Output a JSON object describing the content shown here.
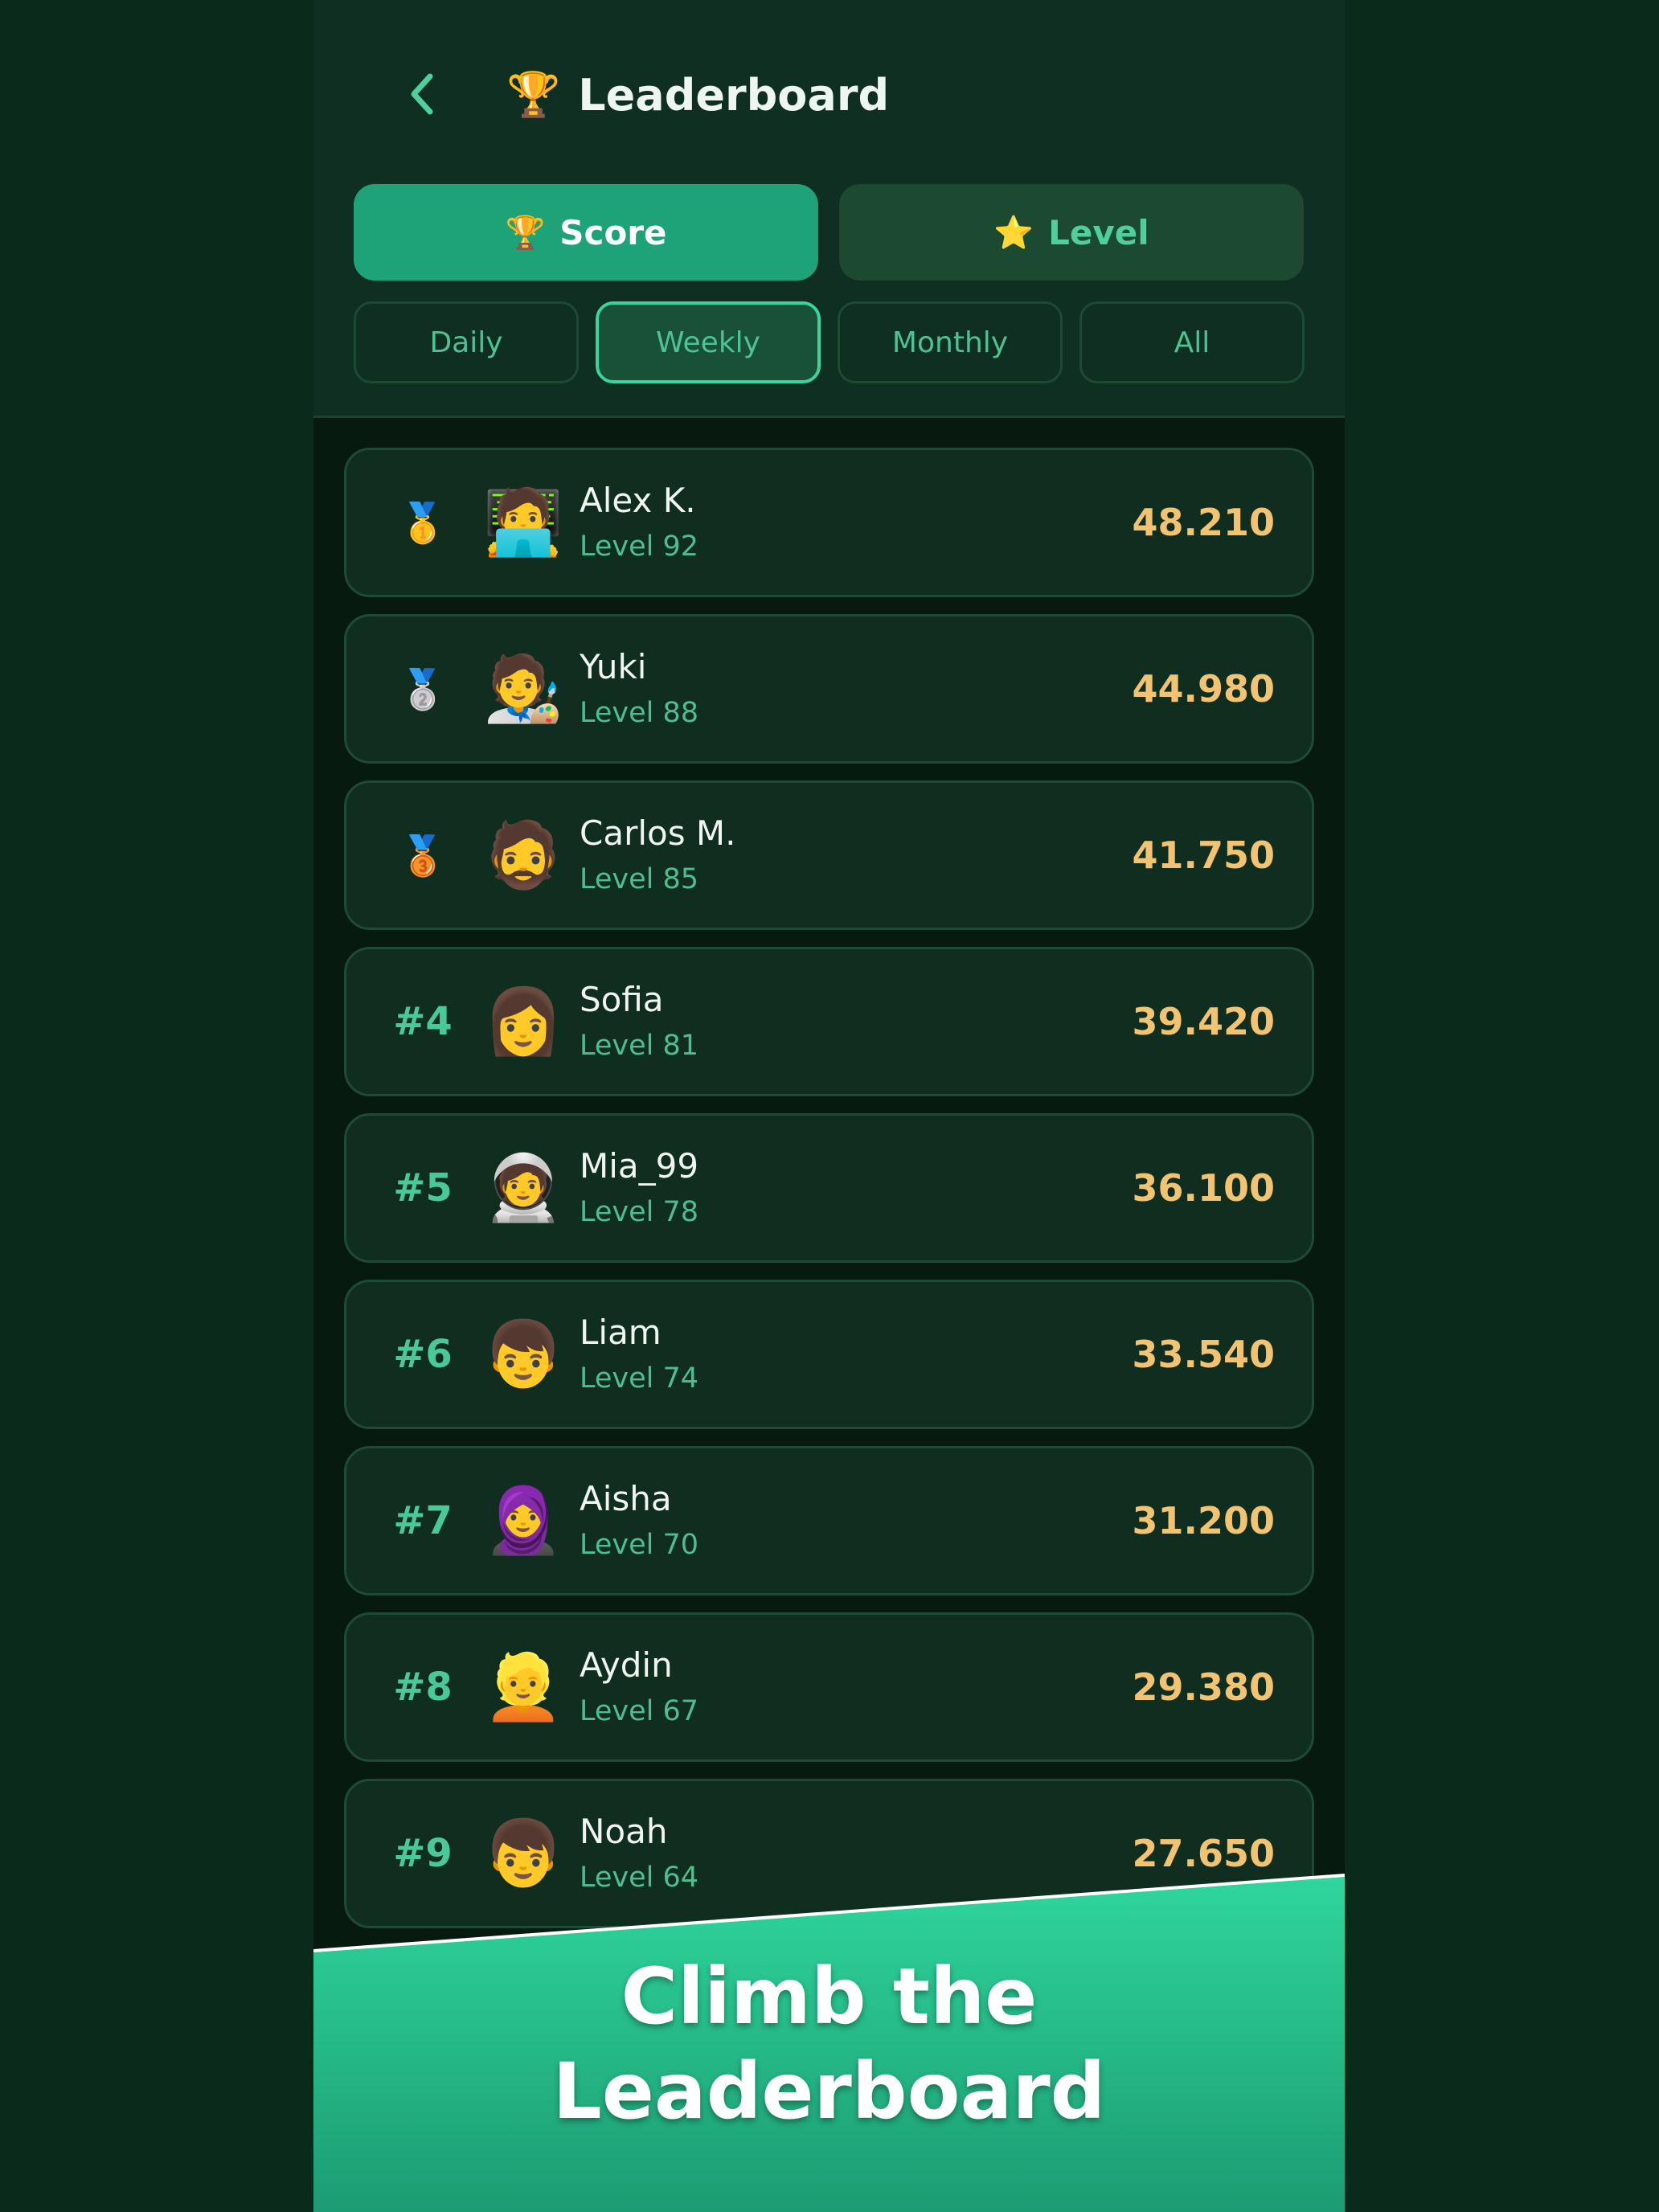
{
  "header": {
    "back_icon": "chevron-left-icon",
    "title_icon": "🏆",
    "title": "Leaderboard"
  },
  "tabs": {
    "score": {
      "icon": "🏆",
      "label": "Score",
      "active": true
    },
    "level": {
      "icon": "⭐",
      "label": "Level",
      "active": false
    }
  },
  "periods": [
    {
      "label": "Daily",
      "active": false
    },
    {
      "label": "Weekly",
      "active": true
    },
    {
      "label": "Monthly",
      "active": false
    },
    {
      "label": "All",
      "active": false
    }
  ],
  "rows": [
    {
      "rank": "🥇",
      "avatar": "🧑‍💻",
      "name": "Alex K.",
      "level": "Level 92",
      "score": "48.210"
    },
    {
      "rank": "🥈",
      "avatar": "🧑‍🎨",
      "name": "Yuki",
      "level": "Level 88",
      "score": "44.980"
    },
    {
      "rank": "🥉",
      "avatar": "🧔",
      "name": "Carlos M.",
      "level": "Level 85",
      "score": "41.750"
    },
    {
      "rank": "#4",
      "avatar": "👩",
      "name": "Sofia",
      "level": "Level 81",
      "score": "39.420"
    },
    {
      "rank": "#5",
      "avatar": "🧑‍🚀",
      "name": "Mia_99",
      "level": "Level 78",
      "score": "36.100"
    },
    {
      "rank": "#6",
      "avatar": "👦",
      "name": "Liam",
      "level": "Level 74",
      "score": "33.540"
    },
    {
      "rank": "#7",
      "avatar": "🧕",
      "name": "Aisha",
      "level": "Level 70",
      "score": "31.200"
    },
    {
      "rank": "#8",
      "avatar": "👱",
      "name": "Aydin",
      "level": "Level 67",
      "score": "29.380"
    },
    {
      "rank": "#9",
      "avatar": "👦",
      "name": "Noah",
      "level": "Level 64",
      "score": "27.650"
    }
  ],
  "banner": {
    "line1": "Climb the",
    "line2": "Leaderboard"
  },
  "colors": {
    "background": "#0a2a1c",
    "accent": "#1ea277",
    "score": "#f2c370",
    "level_text": "#4fbe8f",
    "banner_top": "#2fd69e",
    "banner_bottom": "#1c9c72"
  }
}
